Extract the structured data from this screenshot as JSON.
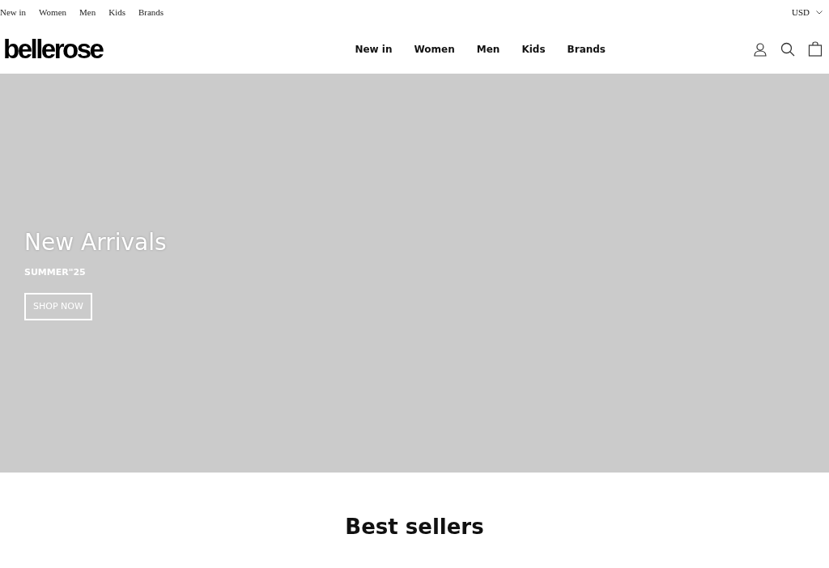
{
  "top_links": [
    "New in",
    "Women",
    "Men",
    "Kids",
    "Brands"
  ],
  "currency": "USD",
  "logo": "bellerose",
  "main_nav": [
    "New in",
    "Women",
    "Men",
    "Kids",
    "Brands"
  ],
  "hero": {
    "title": "New Arrivals",
    "subtitle": "SUMMER\"25",
    "button": "SHOP NOW"
  },
  "section_title": "Best sellers"
}
